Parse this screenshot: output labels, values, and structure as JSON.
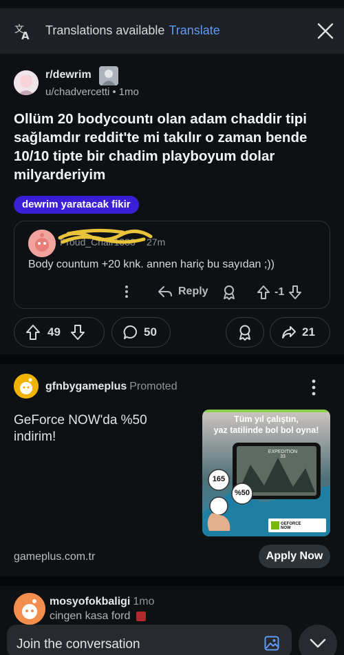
{
  "banner": {
    "text": "Translations available",
    "link": "Translate",
    "icon": "translate-icon"
  },
  "post": {
    "subreddit": "r/dewrim",
    "user": "u/chadvercetti",
    "age": "1mo",
    "title": "Ollüm 20 bodycountı olan adam chaddir tipi sağlamdır reddit'te mi takılır o zaman bende 10/10 tipte bir chadim playboyum dolar milyarderiyim",
    "flair": "dewrim yaratacak fikir",
    "flair_color": "#3a1fd6",
    "comment": {
      "user": "Proud_Chair1388",
      "age": "27m",
      "body": "Body countum +20 knk. annen hariç bu sayıdan ;))",
      "reply_label": "Reply",
      "score": "-1"
    },
    "votes": "49",
    "comments": "50",
    "shares": "21"
  },
  "ad": {
    "advertiser": "gfnbygameplus",
    "promoted_label": "Promoted",
    "text": "GeForce NOW'da %50 indirim!",
    "image_headline_1": "Tüm yıl çalıştın,",
    "image_headline_2": "yaz tatilinde bol bol oyna!",
    "image_game": "EXPEDITION 33",
    "badge_1": "165",
    "badge_2": "%50",
    "image_footer_brand": "GEFORCE NOW",
    "domain": "gameplus.com.tr",
    "cta": "Apply Now",
    "accent": "#76b900"
  },
  "next_post": {
    "user": "mosyofokbaligi",
    "age": "1mo",
    "sub": "cingen kasa ford"
  },
  "composer": {
    "placeholder": "Join the conversation"
  }
}
